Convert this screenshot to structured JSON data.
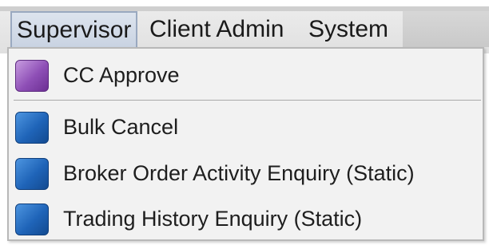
{
  "menubar": {
    "menus": [
      {
        "label": "Supervisor"
      },
      {
        "label": "Client Admin"
      },
      {
        "label": "System"
      }
    ]
  },
  "dropdown": {
    "items": [
      {
        "label": "CC Approve",
        "icon": "purple-square-icon",
        "color": "#8e4fb6"
      },
      {
        "label": "Bulk Cancel",
        "icon": "blue-square-icon",
        "color": "#1f64b8"
      },
      {
        "label": "Broker Order Activity Enquiry (Static)",
        "icon": "blue-square-icon",
        "color": "#1f64b8"
      },
      {
        "label": "Trading History Enquiry (Static)",
        "icon": "blue-square-icon",
        "color": "#1f64b8"
      }
    ]
  }
}
